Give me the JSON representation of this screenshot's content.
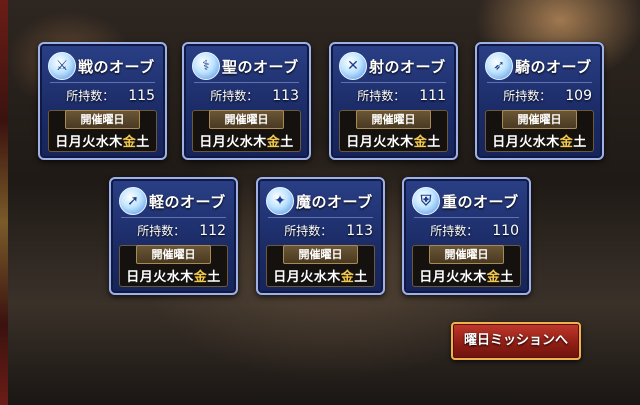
{
  "orbs": [
    {
      "name": "戦のオーブ",
      "count_label": "所持数：",
      "count": "115",
      "day_head": "開催曜日",
      "days": [
        "日",
        "月",
        "火",
        "水",
        "木",
        "金",
        "土"
      ],
      "active_day": "金",
      "icon": "sword-icon"
    },
    {
      "name": "聖のオーブ",
      "count_label": "所持数：",
      "count": "113",
      "day_head": "開催曜日",
      "days": [
        "日",
        "月",
        "火",
        "水",
        "木",
        "金",
        "土"
      ],
      "active_day": "金",
      "icon": "staff-icon"
    },
    {
      "name": "射のオーブ",
      "count_label": "所持数：",
      "count": "111",
      "day_head": "開催曜日",
      "days": [
        "日",
        "月",
        "火",
        "水",
        "木",
        "金",
        "土"
      ],
      "active_day": "金",
      "icon": "crossbow-icon"
    },
    {
      "name": "騎のオーブ",
      "count_label": "所持数：",
      "count": "109",
      "day_head": "開催曜日",
      "days": [
        "日",
        "月",
        "火",
        "水",
        "木",
        "金",
        "土"
      ],
      "active_day": "金",
      "icon": "lance-icon"
    },
    {
      "name": "軽のオーブ",
      "count_label": "所持数：",
      "count": "112",
      "day_head": "開催曜日",
      "days": [
        "日",
        "月",
        "火",
        "水",
        "木",
        "金",
        "土"
      ],
      "active_day": "金",
      "icon": "dagger-icon"
    },
    {
      "name": "魔のオーブ",
      "count_label": "所持数：",
      "count": "113",
      "day_head": "開催曜日",
      "days": [
        "日",
        "月",
        "火",
        "水",
        "木",
        "金",
        "土"
      ],
      "active_day": "金",
      "icon": "wand-icon"
    },
    {
      "name": "重のオーブ",
      "count_label": "所持数：",
      "count": "110",
      "day_head": "開催曜日",
      "days": [
        "日",
        "月",
        "火",
        "水",
        "木",
        "金",
        "土"
      ],
      "active_day": "金",
      "icon": "shield-icon"
    }
  ],
  "mission_button": {
    "label": "曜日ミッションへ"
  },
  "colors": {
    "active_day": "#f2c94c",
    "card_bg": "#1b2b66",
    "button_bg": "#8e1d14"
  }
}
